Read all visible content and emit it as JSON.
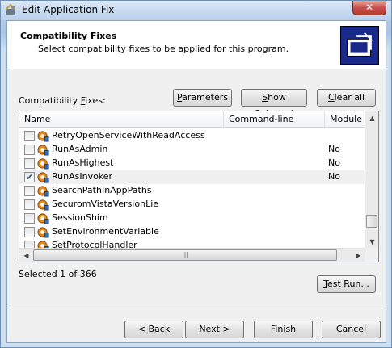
{
  "window": {
    "title": "Edit Application Fix",
    "close_label": "✕"
  },
  "header": {
    "title": "Compatibility Fixes",
    "subtitle": "Select compatibility fixes to be applied for this program."
  },
  "fixes_label": {
    "pre": "Compatibility ",
    "accel": "F",
    "post": "ixes:"
  },
  "toolbar": {
    "parameters": {
      "pre": "",
      "accel": "P",
      "post": "arameters"
    },
    "show_selected": {
      "pre": "",
      "accel": "S",
      "post": "how Selected"
    },
    "clear_all": {
      "pre": "",
      "accel": "C",
      "post": "lear all"
    }
  },
  "columns": [
    "Name",
    "Command-line",
    "Module"
  ],
  "rows": [
    {
      "name": "RetryOpenServiceWithReadAccess",
      "checked": false,
      "module": ""
    },
    {
      "name": "RunAsAdmin",
      "checked": false,
      "module": "No"
    },
    {
      "name": "RunAsHighest",
      "checked": false,
      "module": "No"
    },
    {
      "name": "RunAsInvoker",
      "checked": true,
      "module": "No"
    },
    {
      "name": "SearchPathInAppPaths",
      "checked": false,
      "module": ""
    },
    {
      "name": "SecuromVistaVersionLie",
      "checked": false,
      "module": ""
    },
    {
      "name": "SessionShim",
      "checked": false,
      "module": ""
    },
    {
      "name": "SetEnvironmentVariable",
      "checked": false,
      "module": ""
    },
    {
      "name": "SetProtocolHandler",
      "checked": false,
      "module": ""
    }
  ],
  "status": "Selected 1 of 366",
  "test_run": {
    "pre": "",
    "accel": "T",
    "post": "est Run..."
  },
  "nav": {
    "back": {
      "pre": "< ",
      "accel": "B",
      "post": "ack"
    },
    "next": {
      "pre": "",
      "accel": "N",
      "post": "ext >"
    },
    "finish": "Finish",
    "cancel": "Cancel"
  },
  "icons": {
    "app": "application-fix-icon",
    "fix": "gear-shield-icon",
    "wizard": "compatibility-wizard-icon"
  },
  "colors": {
    "title_bar": "#b9d0ea",
    "close_button": "#c75050",
    "row_highlight": "#f0f0f0",
    "wizard_icon_bg": "#1a2a8a"
  }
}
